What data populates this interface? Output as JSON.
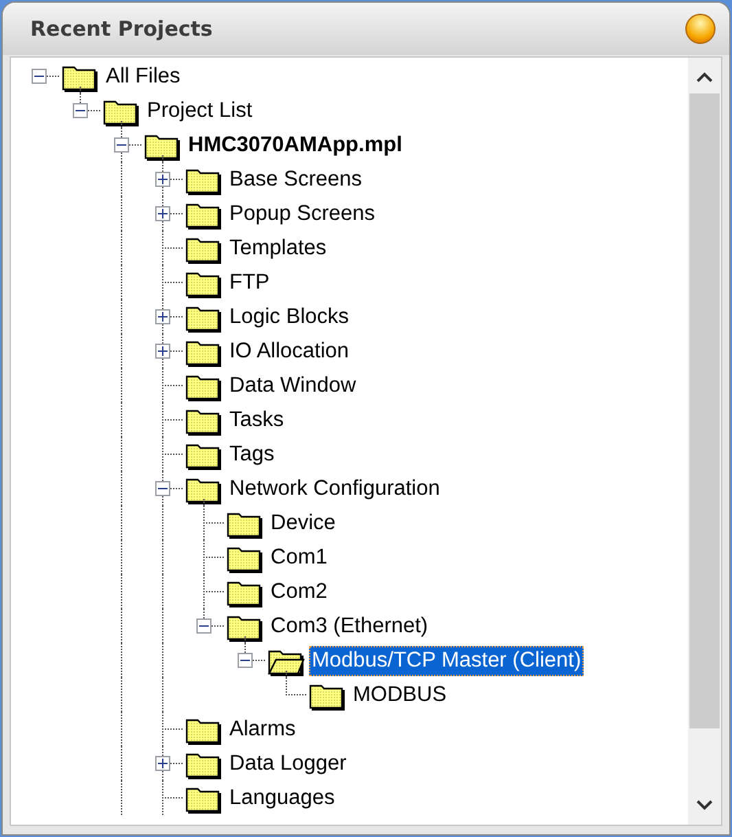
{
  "panel": {
    "title": "Recent Projects"
  },
  "tree": [
    {
      "label": "All Files",
      "expanded": true,
      "selected": false,
      "children": [
        {
          "label": "Project List",
          "expanded": true,
          "selected": false,
          "children": [
            {
              "label": "HMC3070AMApp.mpl",
              "bold": true,
              "expanded": true,
              "selected": false,
              "continues": true,
              "children": [
                {
                  "label": "Base Screens",
                  "expanded": false,
                  "selected": false
                },
                {
                  "label": "Popup Screens",
                  "expanded": false,
                  "selected": false
                },
                {
                  "label": "Templates",
                  "selected": false
                },
                {
                  "label": "FTP",
                  "selected": false
                },
                {
                  "label": "Logic Blocks",
                  "expanded": false,
                  "selected": false
                },
                {
                  "label": "IO Allocation",
                  "expanded": false,
                  "selected": false
                },
                {
                  "label": "Data Window",
                  "selected": false
                },
                {
                  "label": "Tasks",
                  "selected": false
                },
                {
                  "label": "Tags",
                  "selected": false
                },
                {
                  "label": "Network Configuration",
                  "expanded": true,
                  "selected": false,
                  "children": [
                    {
                      "label": "Device",
                      "selected": false
                    },
                    {
                      "label": "Com1",
                      "selected": false
                    },
                    {
                      "label": "Com2",
                      "selected": false
                    },
                    {
                      "label": "Com3 (Ethernet)",
                      "expanded": true,
                      "selected": false,
                      "children": [
                        {
                          "label": "Modbus/TCP Master (Client)",
                          "expanded": true,
                          "selected": true,
                          "children": [
                            {
                              "label": "MODBUS",
                              "selected": false
                            }
                          ]
                        }
                      ]
                    }
                  ]
                },
                {
                  "label": "Alarms",
                  "selected": false
                },
                {
                  "label": "Data Logger",
                  "expanded": false,
                  "selected": false
                },
                {
                  "label": "Languages",
                  "selected": false,
                  "continues": true
                }
              ]
            }
          ]
        }
      ]
    }
  ]
}
